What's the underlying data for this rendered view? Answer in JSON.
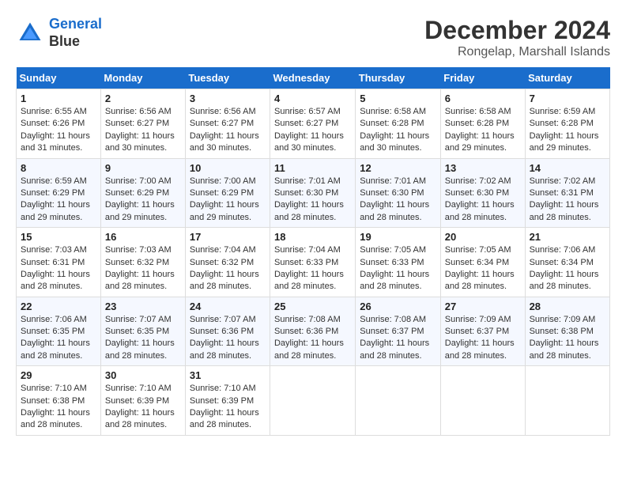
{
  "header": {
    "logo_line1": "General",
    "logo_line2": "Blue",
    "month_year": "December 2024",
    "location": "Rongelap, Marshall Islands"
  },
  "weekdays": [
    "Sunday",
    "Monday",
    "Tuesday",
    "Wednesday",
    "Thursday",
    "Friday",
    "Saturday"
  ],
  "weeks": [
    [
      {
        "day": 1,
        "sunrise": "6:55 AM",
        "sunset": "6:26 PM",
        "daylight": "11 hours and 31 minutes."
      },
      {
        "day": 2,
        "sunrise": "6:56 AM",
        "sunset": "6:27 PM",
        "daylight": "11 hours and 30 minutes."
      },
      {
        "day": 3,
        "sunrise": "6:56 AM",
        "sunset": "6:27 PM",
        "daylight": "11 hours and 30 minutes."
      },
      {
        "day": 4,
        "sunrise": "6:57 AM",
        "sunset": "6:27 PM",
        "daylight": "11 hours and 30 minutes."
      },
      {
        "day": 5,
        "sunrise": "6:58 AM",
        "sunset": "6:28 PM",
        "daylight": "11 hours and 30 minutes."
      },
      {
        "day": 6,
        "sunrise": "6:58 AM",
        "sunset": "6:28 PM",
        "daylight": "11 hours and 29 minutes."
      },
      {
        "day": 7,
        "sunrise": "6:59 AM",
        "sunset": "6:28 PM",
        "daylight": "11 hours and 29 minutes."
      }
    ],
    [
      {
        "day": 8,
        "sunrise": "6:59 AM",
        "sunset": "6:29 PM",
        "daylight": "11 hours and 29 minutes."
      },
      {
        "day": 9,
        "sunrise": "7:00 AM",
        "sunset": "6:29 PM",
        "daylight": "11 hours and 29 minutes."
      },
      {
        "day": 10,
        "sunrise": "7:00 AM",
        "sunset": "6:29 PM",
        "daylight": "11 hours and 29 minutes."
      },
      {
        "day": 11,
        "sunrise": "7:01 AM",
        "sunset": "6:30 PM",
        "daylight": "11 hours and 28 minutes."
      },
      {
        "day": 12,
        "sunrise": "7:01 AM",
        "sunset": "6:30 PM",
        "daylight": "11 hours and 28 minutes."
      },
      {
        "day": 13,
        "sunrise": "7:02 AM",
        "sunset": "6:30 PM",
        "daylight": "11 hours and 28 minutes."
      },
      {
        "day": 14,
        "sunrise": "7:02 AM",
        "sunset": "6:31 PM",
        "daylight": "11 hours and 28 minutes."
      }
    ],
    [
      {
        "day": 15,
        "sunrise": "7:03 AM",
        "sunset": "6:31 PM",
        "daylight": "11 hours and 28 minutes."
      },
      {
        "day": 16,
        "sunrise": "7:03 AM",
        "sunset": "6:32 PM",
        "daylight": "11 hours and 28 minutes."
      },
      {
        "day": 17,
        "sunrise": "7:04 AM",
        "sunset": "6:32 PM",
        "daylight": "11 hours and 28 minutes."
      },
      {
        "day": 18,
        "sunrise": "7:04 AM",
        "sunset": "6:33 PM",
        "daylight": "11 hours and 28 minutes."
      },
      {
        "day": 19,
        "sunrise": "7:05 AM",
        "sunset": "6:33 PM",
        "daylight": "11 hours and 28 minutes."
      },
      {
        "day": 20,
        "sunrise": "7:05 AM",
        "sunset": "6:34 PM",
        "daylight": "11 hours and 28 minutes."
      },
      {
        "day": 21,
        "sunrise": "7:06 AM",
        "sunset": "6:34 PM",
        "daylight": "11 hours and 28 minutes."
      }
    ],
    [
      {
        "day": 22,
        "sunrise": "7:06 AM",
        "sunset": "6:35 PM",
        "daylight": "11 hours and 28 minutes."
      },
      {
        "day": 23,
        "sunrise": "7:07 AM",
        "sunset": "6:35 PM",
        "daylight": "11 hours and 28 minutes."
      },
      {
        "day": 24,
        "sunrise": "7:07 AM",
        "sunset": "6:36 PM",
        "daylight": "11 hours and 28 minutes."
      },
      {
        "day": 25,
        "sunrise": "7:08 AM",
        "sunset": "6:36 PM",
        "daylight": "11 hours and 28 minutes."
      },
      {
        "day": 26,
        "sunrise": "7:08 AM",
        "sunset": "6:37 PM",
        "daylight": "11 hours and 28 minutes."
      },
      {
        "day": 27,
        "sunrise": "7:09 AM",
        "sunset": "6:37 PM",
        "daylight": "11 hours and 28 minutes."
      },
      {
        "day": 28,
        "sunrise": "7:09 AM",
        "sunset": "6:38 PM",
        "daylight": "11 hours and 28 minutes."
      }
    ],
    [
      {
        "day": 29,
        "sunrise": "7:10 AM",
        "sunset": "6:38 PM",
        "daylight": "11 hours and 28 minutes."
      },
      {
        "day": 30,
        "sunrise": "7:10 AM",
        "sunset": "6:39 PM",
        "daylight": "11 hours and 28 minutes."
      },
      {
        "day": 31,
        "sunrise": "7:10 AM",
        "sunset": "6:39 PM",
        "daylight": "11 hours and 28 minutes."
      },
      null,
      null,
      null,
      null
    ]
  ]
}
